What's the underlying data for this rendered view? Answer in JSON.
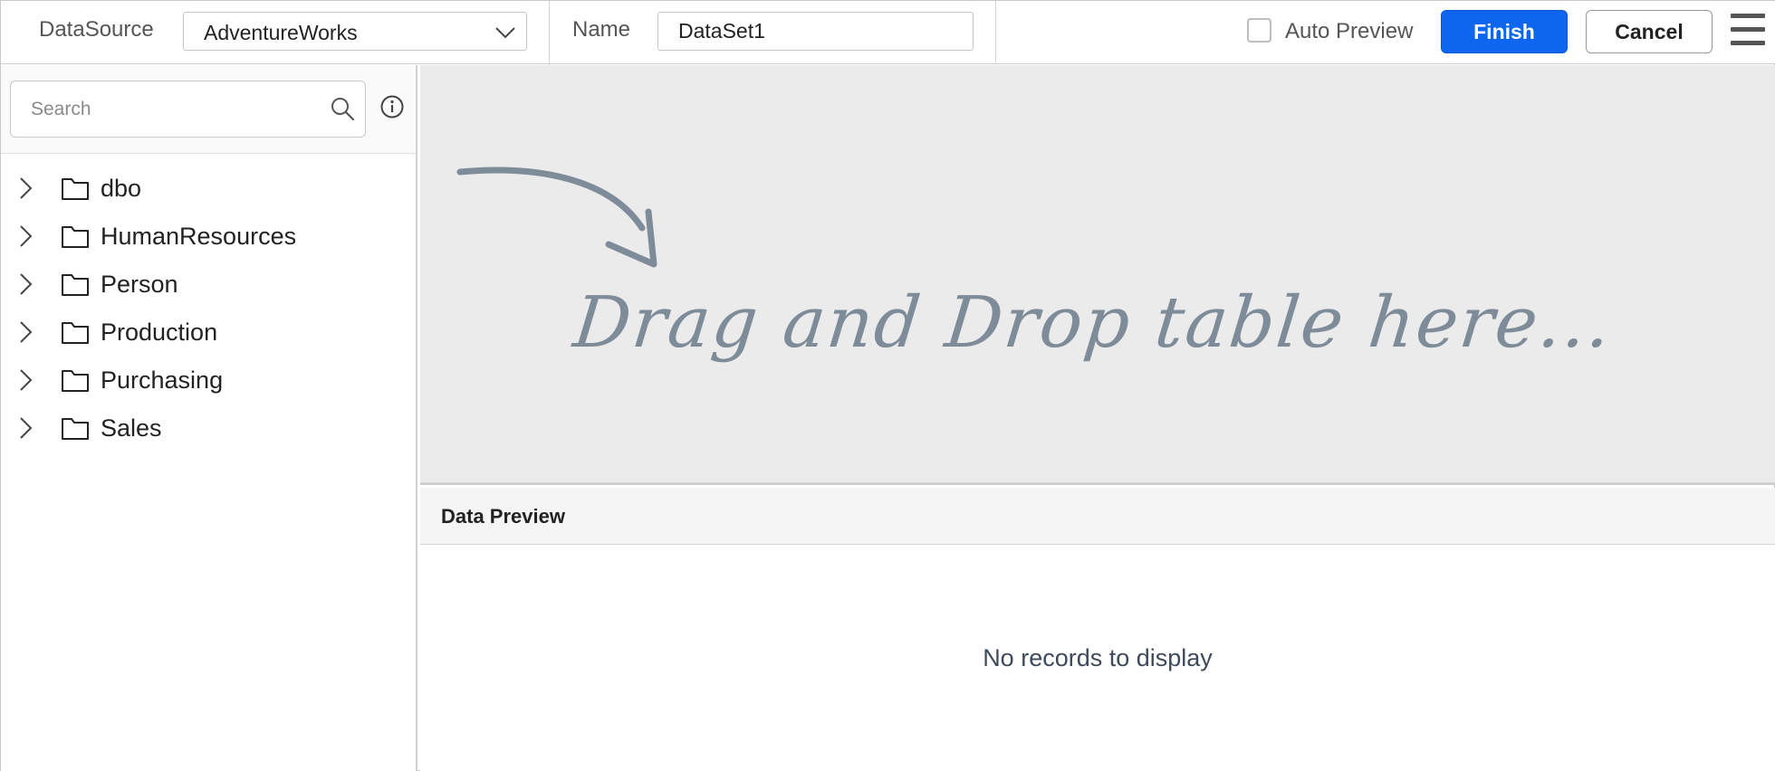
{
  "toolbar": {
    "datasource_label": "DataSource",
    "datasource_value": "AdventureWorks",
    "name_label": "Name",
    "name_value": "DataSet1",
    "auto_preview_label": "Auto Preview",
    "auto_preview_checked": false,
    "finish_label": "Finish",
    "cancel_label": "Cancel",
    "menu_icon": "hamburger-menu-icon"
  },
  "sidebar": {
    "search_placeholder": "Search",
    "search_icon": "search-icon",
    "info_icon": "info-icon",
    "items": [
      {
        "label": "dbo",
        "icon": "folder-icon"
      },
      {
        "label": "HumanResources",
        "icon": "folder-icon"
      },
      {
        "label": "Person",
        "icon": "folder-icon"
      },
      {
        "label": "Production",
        "icon": "folder-icon"
      },
      {
        "label": "Purchasing",
        "icon": "folder-icon"
      },
      {
        "label": "Sales",
        "icon": "folder-icon"
      }
    ]
  },
  "drop_zone": {
    "text": "Drag and Drop table here...",
    "arrow_icon": "curved-arrow-icon"
  },
  "preview": {
    "title": "Data Preview",
    "empty_message": "No records to display"
  },
  "colors": {
    "accent": "#0e66ee",
    "drop_zone_bg": "#ebebeb",
    "drop_text": "#7e8b99"
  }
}
